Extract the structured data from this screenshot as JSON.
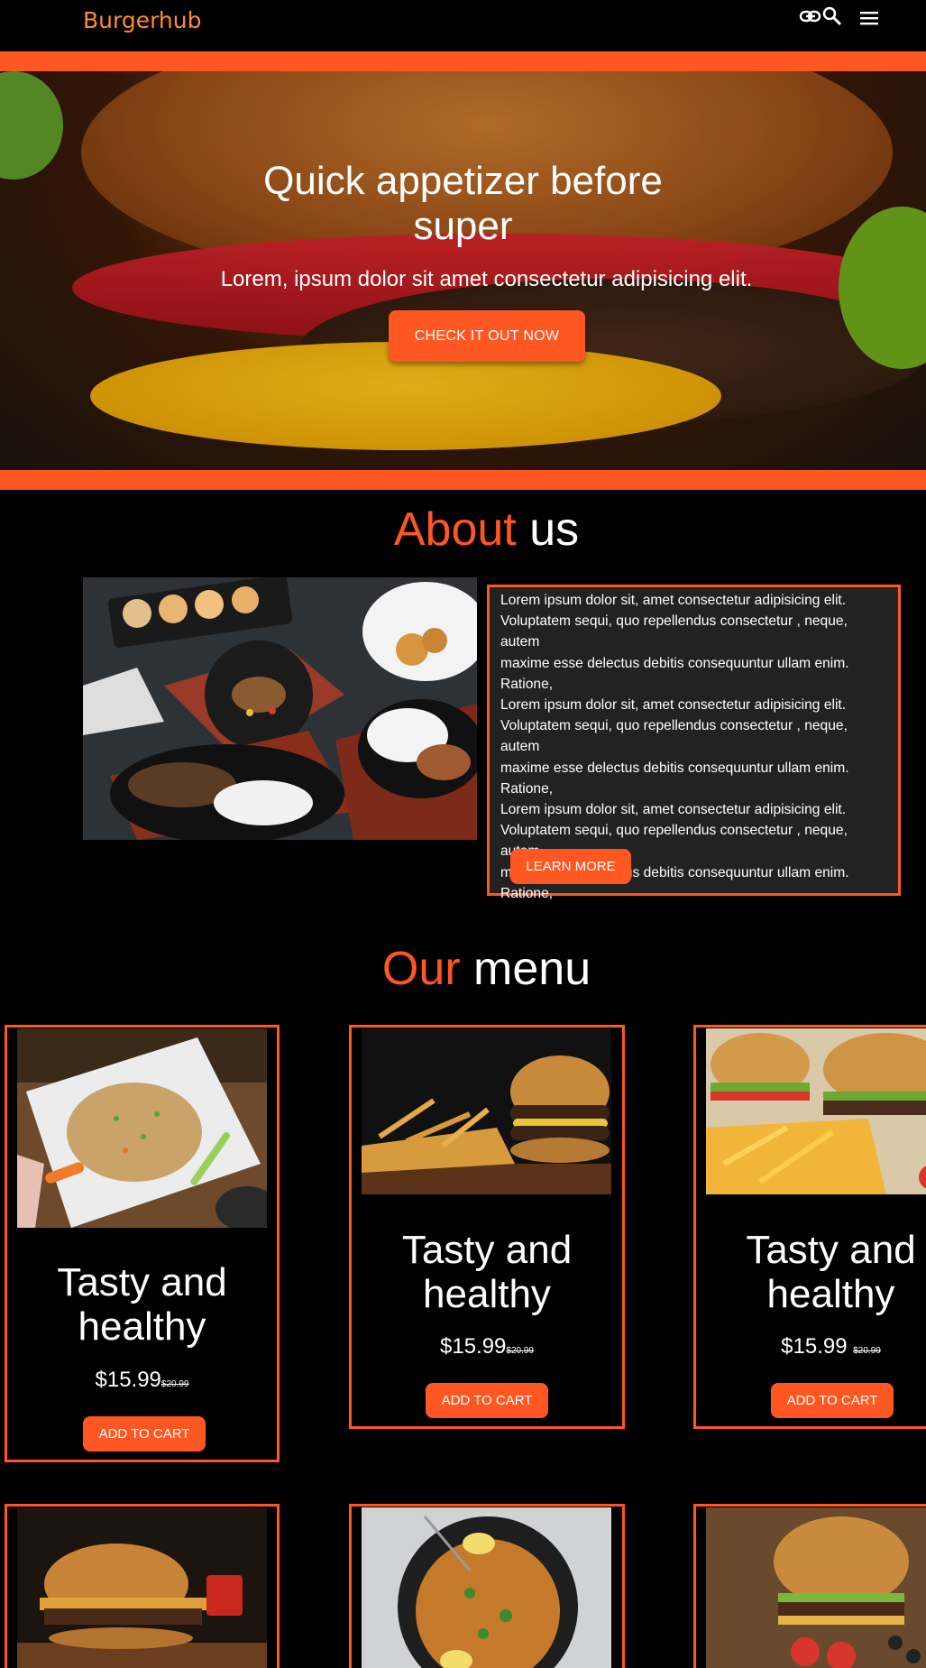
{
  "nav": {
    "brand": "Burgerhub",
    "icons": [
      "link-icon",
      "search-icon",
      "menu-icon"
    ]
  },
  "colors": {
    "accent": "#ff5722",
    "brand": "#ff8c2b",
    "background": "#000000",
    "panel": "#222222"
  },
  "hero": {
    "title_line1": "Quick appetizer before",
    "title_line2": "super",
    "subtitle": "Lorem, ipsum dolor sit amet consectetur adipisicing elit.",
    "cta": "CHECK IT OUT NOW"
  },
  "about": {
    "title_accent": "About",
    "title_rest": "us",
    "paragraph_lines": [
      "Lorem ipsum dolor sit, amet consectetur adipisicing elit.",
      "Voluptatem sequi, quo repellendus consectetur , neque, autem",
      "maxime esse delectus debitis consequuntur ullam enim.",
      "Ratione,",
      "Lorem ipsum dolor sit, amet consectetur adipisicing elit.",
      "Voluptatem sequi, quo repellendus consectetur , neque, autem",
      "maxime esse delectus debitis consequuntur ullam enim.",
      "Ratione,",
      "Lorem ipsum dolor sit, amet consectetur adipisicing elit.",
      "Voluptatem sequi, quo repellendus consectetur , neque, autem",
      "maxime esse delectus debitis consequuntur ullam enim.",
      "Ratione,"
    ],
    "button": "LEARN MORE"
  },
  "menu": {
    "title_accent": "Our",
    "title_rest": "menu",
    "items": [
      {
        "name_line1": "Tasty and",
        "name_line2": "healthy",
        "price": "$15.99",
        "old_price": "$20.99",
        "button": "ADD TO CART"
      },
      {
        "name_line1": "Tasty and",
        "name_line2": "healthy",
        "price": "$15.99",
        "old_price": "$20.99",
        "button": "ADD TO CART"
      },
      {
        "name_line1": "Tasty and",
        "name_line2": "healthy",
        "price": "$15.99 ",
        "old_price": "$20.99",
        "button": "ADD TO CART"
      }
    ]
  }
}
